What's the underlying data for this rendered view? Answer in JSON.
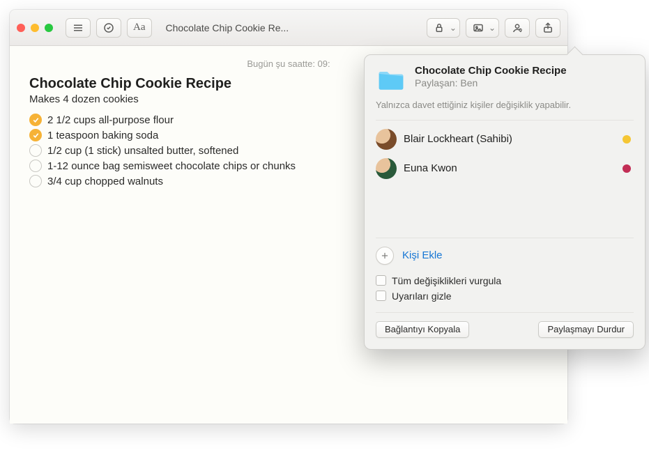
{
  "toolbar": {
    "title": "Chocolate Chip Cookie Re..."
  },
  "note": {
    "timestamp": "Bugün şu saatte: 09:",
    "title": "Chocolate Chip Cookie Recipe",
    "subtitle": "Makes 4 dozen cookies",
    "items": [
      {
        "text": "2 1/2 cups all-purpose flour",
        "done": true
      },
      {
        "text": "1 teaspoon baking soda",
        "done": true
      },
      {
        "text": "1/2 cup (1 stick) unsalted butter, softened",
        "done": false
      },
      {
        "text": "1-12 ounce bag semisweet chocolate chips or chunks",
        "done": false
      },
      {
        "text": "3/4 cup chopped walnuts",
        "done": false
      }
    ]
  },
  "share": {
    "title": "Chocolate Chip Cookie Recipe",
    "subtitle": "Paylaşan: Ben",
    "permission_note": "Yalnızca davet ettiğiniz kişiler değişiklik yapabilir.",
    "people": [
      {
        "name": "Blair Lockheart (Sahibi)",
        "color": "y"
      },
      {
        "name": "Euna Kwon",
        "color": "r"
      }
    ],
    "add_label": "Kişi Ekle",
    "options": {
      "highlight": "Tüm değişiklikleri vurgula",
      "hide_alerts": "Uyarıları gizle"
    },
    "actions": {
      "copy_link": "Bağlantıyı Kopyala",
      "stop_sharing": "Paylaşmayı Durdur"
    }
  }
}
